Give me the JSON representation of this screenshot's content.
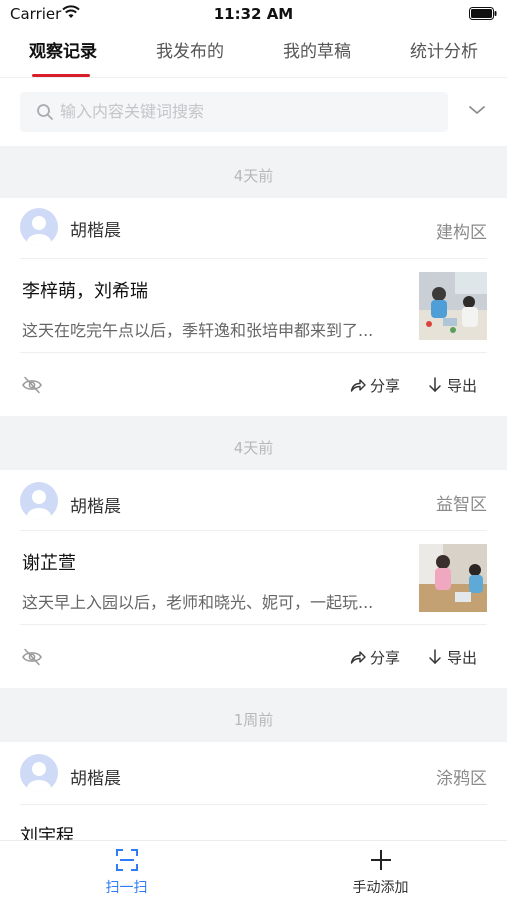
{
  "status_bar": {
    "carrier": "Carrier",
    "time": "11:32 AM"
  },
  "tabs": [
    {
      "label": "观察记录",
      "active": true
    },
    {
      "label": "我发布的",
      "active": false
    },
    {
      "label": "我的草稿",
      "active": false
    },
    {
      "label": "统计分析",
      "active": false
    }
  ],
  "search": {
    "placeholder": "输入内容关键词搜索"
  },
  "groups": [
    {
      "date": "4天前",
      "card": {
        "author": "胡楷晨",
        "area": "建构区",
        "title": "李梓萌，刘希瑞",
        "excerpt": "这天在吃完午点以后，季轩逸和张培申都来到了...",
        "share_label": "分享",
        "export_label": "导出"
      }
    },
    {
      "date": "4天前",
      "card": {
        "author": "胡楷晨",
        "area": "益智区",
        "title": "谢芷萱",
        "excerpt": "这天早上入园以后，老师和晓光、妮可，一起玩...",
        "share_label": "分享",
        "export_label": "导出"
      }
    },
    {
      "date": "1周前",
      "card": {
        "author": "胡楷晨",
        "area": "涂鸦区",
        "title": "刘宇程"
      }
    }
  ],
  "bottom_bar": {
    "scan_label": "扫一扫",
    "add_label": "手动添加",
    "accent_color": "#2f7cf6"
  },
  "colors": {
    "tab_indicator": "#d81e2b",
    "accent": "#2f7cf6"
  }
}
